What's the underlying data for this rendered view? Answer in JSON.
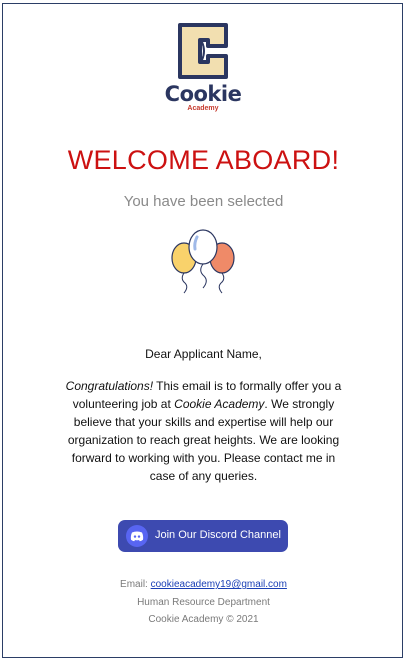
{
  "logo": {
    "wordmark": "Cookie",
    "subtitle": "Academy",
    "colors": {
      "navy": "#2b3660",
      "cream": "#f2dfb0",
      "red": "#c63b2e"
    }
  },
  "heading": "WELCOME ABOARD!",
  "subheading": "You have been selected",
  "balloons_icon": "balloons-icon",
  "greeting": "Dear Applicant Name,",
  "body": {
    "intro_italic": "Congratulations!",
    "part1": " This email is to formally offer you a volunteering job at ",
    "company_italic": "Cookie Academy",
    "part2": ". We strongly believe that your skills and expertise will help our organization to reach great heights. We are looking forward to working with you. Please contact me in case of any queries."
  },
  "discord_button": {
    "label": "Join Our Discord Channel",
    "icon": "discord-icon",
    "color": "#3d4ab0"
  },
  "footer": {
    "email_label": "Email: ",
    "email": "cookieacademy19@gmail.com",
    "department": "Human Resource Department",
    "copyright": "Cookie Academy © 2021"
  }
}
